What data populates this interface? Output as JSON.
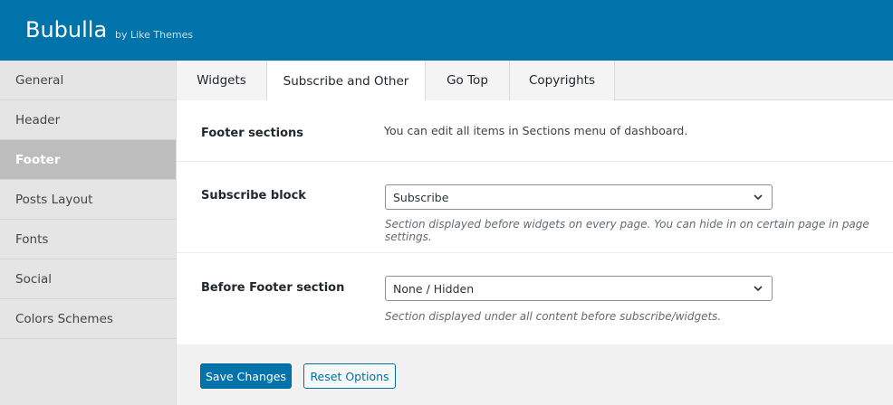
{
  "header": {
    "brand": "Bubulla",
    "byline": "by Like Themes"
  },
  "sidebar": {
    "items": [
      {
        "label": "General"
      },
      {
        "label": "Header"
      },
      {
        "label": "Footer",
        "active": true
      },
      {
        "label": "Posts Layout"
      },
      {
        "label": "Fonts"
      },
      {
        "label": "Social"
      },
      {
        "label": "Colors Schemes"
      }
    ]
  },
  "tabs": [
    {
      "label": "Widgets"
    },
    {
      "label": "Subscribe and Other",
      "active": true
    },
    {
      "label": "Go Top"
    },
    {
      "label": "Copyrights"
    }
  ],
  "settings": {
    "footer_sections": {
      "label": "Footer sections",
      "info": "You can edit all items in Sections menu of dashboard."
    },
    "subscribe_block": {
      "label": "Subscribe block",
      "value": "Subscribe",
      "description": "Section displayed before widgets on every page. You can hide in on certain page in page settings."
    },
    "before_footer": {
      "label": "Before Footer section",
      "value": "None / Hidden",
      "description": "Section displayed under all content before subscribe/widgets."
    }
  },
  "actions": {
    "save_label": "Save Changes",
    "reset_label": "Reset Options"
  },
  "colors": {
    "header_bg": "#0073aa",
    "primary_button": "#0073aa",
    "active_sidebar": "#bdbdbd"
  }
}
